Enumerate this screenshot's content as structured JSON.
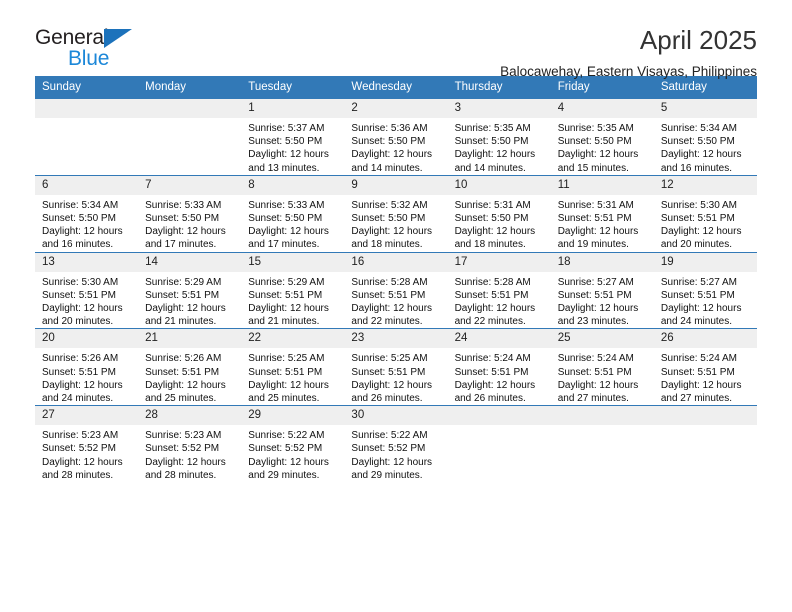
{
  "brand": {
    "name_top": "General",
    "name_bottom": "Blue",
    "triangle_color": "#1c72bb",
    "blue_color": "#1c87d8"
  },
  "header": {
    "title": "April 2025",
    "subtitle": "Balocawehay, Eastern Visayas, Philippines"
  },
  "theme": {
    "header_row_bg": "#3279b7",
    "daynum_bg": "#efefef",
    "grid_line": "#3279b7"
  },
  "weekday_headers": [
    "Sunday",
    "Monday",
    "Tuesday",
    "Wednesday",
    "Thursday",
    "Friday",
    "Saturday"
  ],
  "weeks": [
    [
      {
        "day": "",
        "sunrise": "",
        "sunset": "",
        "daylight_line1": "",
        "daylight_line2": ""
      },
      {
        "day": "",
        "sunrise": "",
        "sunset": "",
        "daylight_line1": "",
        "daylight_line2": ""
      },
      {
        "day": "1",
        "sunrise": "Sunrise: 5:37 AM",
        "sunset": "Sunset: 5:50 PM",
        "daylight_line1": "Daylight: 12 hours",
        "daylight_line2": "and 13 minutes."
      },
      {
        "day": "2",
        "sunrise": "Sunrise: 5:36 AM",
        "sunset": "Sunset: 5:50 PM",
        "daylight_line1": "Daylight: 12 hours",
        "daylight_line2": "and 14 minutes."
      },
      {
        "day": "3",
        "sunrise": "Sunrise: 5:35 AM",
        "sunset": "Sunset: 5:50 PM",
        "daylight_line1": "Daylight: 12 hours",
        "daylight_line2": "and 14 minutes."
      },
      {
        "day": "4",
        "sunrise": "Sunrise: 5:35 AM",
        "sunset": "Sunset: 5:50 PM",
        "daylight_line1": "Daylight: 12 hours",
        "daylight_line2": "and 15 minutes."
      },
      {
        "day": "5",
        "sunrise": "Sunrise: 5:34 AM",
        "sunset": "Sunset: 5:50 PM",
        "daylight_line1": "Daylight: 12 hours",
        "daylight_line2": "and 16 minutes."
      }
    ],
    [
      {
        "day": "6",
        "sunrise": "Sunrise: 5:34 AM",
        "sunset": "Sunset: 5:50 PM",
        "daylight_line1": "Daylight: 12 hours",
        "daylight_line2": "and 16 minutes."
      },
      {
        "day": "7",
        "sunrise": "Sunrise: 5:33 AM",
        "sunset": "Sunset: 5:50 PM",
        "daylight_line1": "Daylight: 12 hours",
        "daylight_line2": "and 17 minutes."
      },
      {
        "day": "8",
        "sunrise": "Sunrise: 5:33 AM",
        "sunset": "Sunset: 5:50 PM",
        "daylight_line1": "Daylight: 12 hours",
        "daylight_line2": "and 17 minutes."
      },
      {
        "day": "9",
        "sunrise": "Sunrise: 5:32 AM",
        "sunset": "Sunset: 5:50 PM",
        "daylight_line1": "Daylight: 12 hours",
        "daylight_line2": "and 18 minutes."
      },
      {
        "day": "10",
        "sunrise": "Sunrise: 5:31 AM",
        "sunset": "Sunset: 5:50 PM",
        "daylight_line1": "Daylight: 12 hours",
        "daylight_line2": "and 18 minutes."
      },
      {
        "day": "11",
        "sunrise": "Sunrise: 5:31 AM",
        "sunset": "Sunset: 5:51 PM",
        "daylight_line1": "Daylight: 12 hours",
        "daylight_line2": "and 19 minutes."
      },
      {
        "day": "12",
        "sunrise": "Sunrise: 5:30 AM",
        "sunset": "Sunset: 5:51 PM",
        "daylight_line1": "Daylight: 12 hours",
        "daylight_line2": "and 20 minutes."
      }
    ],
    [
      {
        "day": "13",
        "sunrise": "Sunrise: 5:30 AM",
        "sunset": "Sunset: 5:51 PM",
        "daylight_line1": "Daylight: 12 hours",
        "daylight_line2": "and 20 minutes."
      },
      {
        "day": "14",
        "sunrise": "Sunrise: 5:29 AM",
        "sunset": "Sunset: 5:51 PM",
        "daylight_line1": "Daylight: 12 hours",
        "daylight_line2": "and 21 minutes."
      },
      {
        "day": "15",
        "sunrise": "Sunrise: 5:29 AM",
        "sunset": "Sunset: 5:51 PM",
        "daylight_line1": "Daylight: 12 hours",
        "daylight_line2": "and 21 minutes."
      },
      {
        "day": "16",
        "sunrise": "Sunrise: 5:28 AM",
        "sunset": "Sunset: 5:51 PM",
        "daylight_line1": "Daylight: 12 hours",
        "daylight_line2": "and 22 minutes."
      },
      {
        "day": "17",
        "sunrise": "Sunrise: 5:28 AM",
        "sunset": "Sunset: 5:51 PM",
        "daylight_line1": "Daylight: 12 hours",
        "daylight_line2": "and 22 minutes."
      },
      {
        "day": "18",
        "sunrise": "Sunrise: 5:27 AM",
        "sunset": "Sunset: 5:51 PM",
        "daylight_line1": "Daylight: 12 hours",
        "daylight_line2": "and 23 minutes."
      },
      {
        "day": "19",
        "sunrise": "Sunrise: 5:27 AM",
        "sunset": "Sunset: 5:51 PM",
        "daylight_line1": "Daylight: 12 hours",
        "daylight_line2": "and 24 minutes."
      }
    ],
    [
      {
        "day": "20",
        "sunrise": "Sunrise: 5:26 AM",
        "sunset": "Sunset: 5:51 PM",
        "daylight_line1": "Daylight: 12 hours",
        "daylight_line2": "and 24 minutes."
      },
      {
        "day": "21",
        "sunrise": "Sunrise: 5:26 AM",
        "sunset": "Sunset: 5:51 PM",
        "daylight_line1": "Daylight: 12 hours",
        "daylight_line2": "and 25 minutes."
      },
      {
        "day": "22",
        "sunrise": "Sunrise: 5:25 AM",
        "sunset": "Sunset: 5:51 PM",
        "daylight_line1": "Daylight: 12 hours",
        "daylight_line2": "and 25 minutes."
      },
      {
        "day": "23",
        "sunrise": "Sunrise: 5:25 AM",
        "sunset": "Sunset: 5:51 PM",
        "daylight_line1": "Daylight: 12 hours",
        "daylight_line2": "and 26 minutes."
      },
      {
        "day": "24",
        "sunrise": "Sunrise: 5:24 AM",
        "sunset": "Sunset: 5:51 PM",
        "daylight_line1": "Daylight: 12 hours",
        "daylight_line2": "and 26 minutes."
      },
      {
        "day": "25",
        "sunrise": "Sunrise: 5:24 AM",
        "sunset": "Sunset: 5:51 PM",
        "daylight_line1": "Daylight: 12 hours",
        "daylight_line2": "and 27 minutes."
      },
      {
        "day": "26",
        "sunrise": "Sunrise: 5:24 AM",
        "sunset": "Sunset: 5:51 PM",
        "daylight_line1": "Daylight: 12 hours",
        "daylight_line2": "and 27 minutes."
      }
    ],
    [
      {
        "day": "27",
        "sunrise": "Sunrise: 5:23 AM",
        "sunset": "Sunset: 5:52 PM",
        "daylight_line1": "Daylight: 12 hours",
        "daylight_line2": "and 28 minutes."
      },
      {
        "day": "28",
        "sunrise": "Sunrise: 5:23 AM",
        "sunset": "Sunset: 5:52 PM",
        "daylight_line1": "Daylight: 12 hours",
        "daylight_line2": "and 28 minutes."
      },
      {
        "day": "29",
        "sunrise": "Sunrise: 5:22 AM",
        "sunset": "Sunset: 5:52 PM",
        "daylight_line1": "Daylight: 12 hours",
        "daylight_line2": "and 29 minutes."
      },
      {
        "day": "30",
        "sunrise": "Sunrise: 5:22 AM",
        "sunset": "Sunset: 5:52 PM",
        "daylight_line1": "Daylight: 12 hours",
        "daylight_line2": "and 29 minutes."
      },
      {
        "day": "",
        "sunrise": "",
        "sunset": "",
        "daylight_line1": "",
        "daylight_line2": ""
      },
      {
        "day": "",
        "sunrise": "",
        "sunset": "",
        "daylight_line1": "",
        "daylight_line2": ""
      },
      {
        "day": "",
        "sunrise": "",
        "sunset": "",
        "daylight_line1": "",
        "daylight_line2": ""
      }
    ]
  ]
}
